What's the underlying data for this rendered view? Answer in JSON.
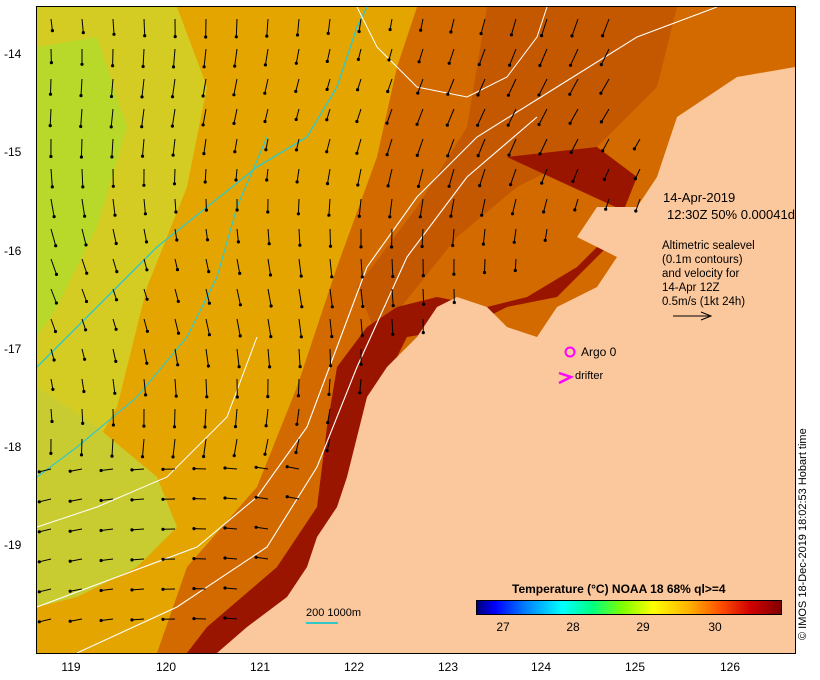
{
  "map": {
    "lon_ticks": [
      "119",
      "120",
      "121",
      "122",
      "123",
      "124",
      "125",
      "126"
    ],
    "lat_ticks": [
      "-14",
      "-15",
      "-16",
      "-17",
      "-18",
      "-19"
    ],
    "info_date": "14-Apr-2019",
    "info_time": "12:30Z  50% 0.00041d",
    "altimetry_lines": [
      "Altimetric sealevel",
      "(0.1m contours)",
      "and velocity for",
      "14-Apr 12Z",
      "0.5m/s (1kt 24h)"
    ],
    "argo_label": "Argo 0",
    "drifter_label": "drifter",
    "scale_label": "200  1000m",
    "credit": "© IMOS 18-Dec-2019 18:02:53 Hobart time",
    "legend_title": "Temperature (°C) NOAA 18 68% ql>=4",
    "legend_ticks": [
      "27",
      "28",
      "29",
      "30"
    ],
    "colors": {
      "land": "#fbc79c",
      "warm_water": "#d26a00",
      "hot_water": "#9a1500",
      "cool_water": "#e8dc20",
      "bathymetry": "#33c8c8",
      "contour": "#ffffff",
      "argo": "#ff00ff"
    }
  }
}
